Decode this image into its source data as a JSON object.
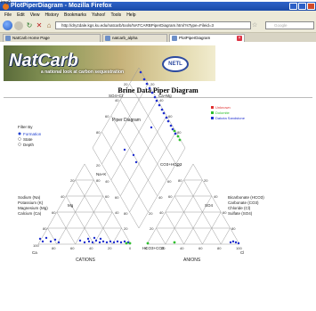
{
  "image_label": "img0",
  "window": {
    "title": "PlotPiperDiagram - Mozilla Firefox"
  },
  "menu": [
    "File",
    "Edit",
    "View",
    "History",
    "Bookmarks",
    "Yahoo!",
    "Tools",
    "Help"
  ],
  "nav": {
    "url": "http://dryzdale.kgs.ku.edu/natcarb/tools/NATCARBPiperDiagram.html?sType=Fileid=3",
    "search_placeholder": "Google"
  },
  "tabs": [
    {
      "label": "NatCarb Home Page"
    },
    {
      "label": "natcarb_alpha"
    },
    {
      "label": "PlotPiperDiagram"
    }
  ],
  "banner": {
    "brand": "NatCarb",
    "subtitle": "a national look at carbon sequestration",
    "partner": "NETL"
  },
  "page_title": "Brine Data Piper Diagram",
  "diagram": {
    "label": "Piper Diagram",
    "filter_title": "Filter By",
    "filters": [
      {
        "label": "Formation",
        "selected": true
      },
      {
        "label": "State",
        "selected": false
      },
      {
        "label": "Depth",
        "selected": false
      }
    ],
    "legend": [
      {
        "label": "Unknown",
        "color": "#e03030"
      },
      {
        "label": "Dolomite",
        "color": "#30c030"
      },
      {
        "label": "Dakota Sandstone",
        "color": "#2030d0"
      }
    ],
    "cation_labels": [
      "Sodium (Na)",
      "Potassium (K)",
      "Magnesium (Mg)",
      "Calcium (Ca)"
    ],
    "anion_labels": [
      "Bicarbonate (HCO3)",
      "Carbonate (CO3)",
      "Chloride (Cl)",
      "Sulfate (SO4)"
    ],
    "axis": {
      "cations": "CATIONS",
      "anions": "ANIONS",
      "na_k": "Na+K",
      "ca": "Ca",
      "mg": "Mg",
      "cl": "Cl",
      "so4": "SO4",
      "hco3_co3": "HCO3+CO3",
      "so4_cl": "SO4+Cl",
      "ca_mg": "Ca+Mg",
      "co3_hco3": "CO3+HCO3",
      "so4_plus_cl": "SO4+Cl"
    }
  }
}
